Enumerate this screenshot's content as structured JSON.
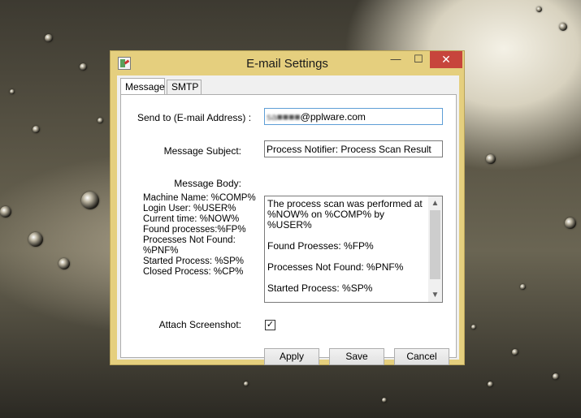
{
  "window": {
    "title": "E-mail Settings",
    "minimize": "—",
    "maximize": "☐",
    "close": "✕"
  },
  "tabs": [
    {
      "label": "Message"
    },
    {
      "label": "SMTP"
    }
  ],
  "form": {
    "send_to_label": "Send to (E-mail Address) :",
    "send_to_blurred": "sa■■■■",
    "send_to_value": "@pplware.com",
    "subject_label": "Message Subject:",
    "subject_value": "Process Notifier: Process Scan Result",
    "body_label": "Message Body:",
    "variables": [
      "Machine Name: %COMP%",
      "Login User: %USER%",
      "Current time: %NOW%",
      "Found processes:%FP%",
      "Processes Not Found:",
      "%PNF%",
      "Started Process: %SP%",
      "Closed Process: %CP%"
    ],
    "body_lines": [
      "The process scan was performed at",
      "%NOW% on %COMP% by %USER%",
      "",
      "Found Proesses: %FP%",
      "",
      "Processes Not Found: %PNF%",
      "",
      "Started Process: %SP%"
    ],
    "attach_label": "Attach Screenshot:",
    "attach_checked": "✓"
  },
  "buttons": {
    "apply": "Apply",
    "save": "Save",
    "cancel": "Cancel"
  }
}
